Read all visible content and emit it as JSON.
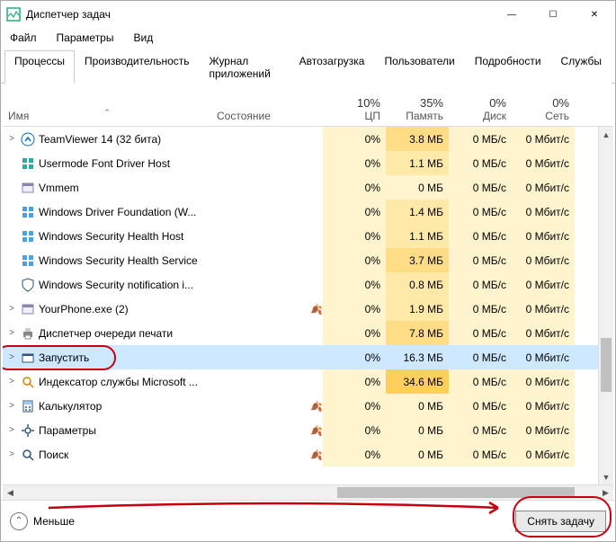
{
  "window": {
    "title": "Диспетчер задач",
    "min": "—",
    "max": "☐",
    "close": "✕"
  },
  "menu": {
    "file": "Файл",
    "options": "Параметры",
    "view": "Вид"
  },
  "tabs": {
    "processes": "Процессы",
    "performance": "Производительность",
    "app_history": "Журнал приложений",
    "startup": "Автозагрузка",
    "users": "Пользователи",
    "details": "Подробности",
    "services": "Службы"
  },
  "columns": {
    "name": "Имя",
    "status": "Состояние",
    "cpu_pct": "10%",
    "cpu_label": "ЦП",
    "mem_pct": "35%",
    "mem_label": "Память",
    "disk_pct": "0%",
    "disk_label": "Диск",
    "net_pct": "0%",
    "net_label": "Сеть"
  },
  "rows": [
    {
      "exp": ">",
      "name": "TeamViewer 14 (32 бита)",
      "cpu": "0%",
      "mem": "3.8 МБ",
      "disk": "0 МБ/с",
      "net": "0 Мбит/с",
      "mem_heat": "med",
      "leaf": false,
      "icon": "tv"
    },
    {
      "exp": "",
      "name": "Usermode Font Driver Host",
      "cpu": "0%",
      "mem": "1.1 МБ",
      "disk": "0 МБ/с",
      "net": "0 Мбит/с",
      "mem_heat": "light",
      "leaf": false,
      "icon": "win"
    },
    {
      "exp": "",
      "name": "Vmmem",
      "cpu": "0%",
      "mem": "0 МБ",
      "disk": "0 МБ/с",
      "net": "0 Мбит/с",
      "mem_heat": "none",
      "leaf": false,
      "icon": "exe"
    },
    {
      "exp": "",
      "name": "Windows Driver Foundation (W...",
      "cpu": "0%",
      "mem": "1.4 МБ",
      "disk": "0 МБ/с",
      "net": "0 Мбит/с",
      "mem_heat": "light",
      "leaf": false,
      "icon": "svc"
    },
    {
      "exp": "",
      "name": "Windows Security Health Host",
      "cpu": "0%",
      "mem": "1.1 МБ",
      "disk": "0 МБ/с",
      "net": "0 Мбит/с",
      "mem_heat": "light",
      "leaf": false,
      "icon": "svc"
    },
    {
      "exp": "",
      "name": "Windows Security Health Service",
      "cpu": "0%",
      "mem": "3.7 МБ",
      "disk": "0 МБ/с",
      "net": "0 Мбит/с",
      "mem_heat": "med",
      "leaf": false,
      "icon": "svc"
    },
    {
      "exp": "",
      "name": "Windows Security notification i...",
      "cpu": "0%",
      "mem": "0.8 МБ",
      "disk": "0 МБ/с",
      "net": "0 Мбит/с",
      "mem_heat": "light",
      "leaf": false,
      "icon": "shield"
    },
    {
      "exp": ">",
      "name": "YourPhone.exe (2)",
      "cpu": "0%",
      "mem": "1.9 МБ",
      "disk": "0 МБ/с",
      "net": "0 Мбит/с",
      "mem_heat": "light",
      "leaf": true,
      "icon": "exe"
    },
    {
      "exp": ">",
      "name": "Диспетчер очереди печати",
      "cpu": "0%",
      "mem": "7.8 МБ",
      "disk": "0 МБ/с",
      "net": "0 Мбит/с",
      "mem_heat": "med",
      "leaf": false,
      "icon": "printer"
    },
    {
      "exp": ">",
      "name": "Запустить",
      "cpu": "0%",
      "mem": "16.3 МБ",
      "disk": "0 МБ/с",
      "net": "0 Мбит/с",
      "mem_heat": "dark",
      "leaf": false,
      "icon": "run",
      "selected": true
    },
    {
      "exp": ">",
      "name": "Индексатор службы Microsoft ...",
      "cpu": "0%",
      "mem": "34.6 МБ",
      "disk": "0 МБ/с",
      "net": "0 Мбит/с",
      "mem_heat": "dark",
      "leaf": false,
      "icon": "index"
    },
    {
      "exp": ">",
      "name": "Калькулятор",
      "cpu": "0%",
      "mem": "0 МБ",
      "disk": "0 МБ/с",
      "net": "0 Мбит/с",
      "mem_heat": "none",
      "leaf": true,
      "icon": "calc"
    },
    {
      "exp": ">",
      "name": "Параметры",
      "cpu": "0%",
      "mem": "0 МБ",
      "disk": "0 МБ/с",
      "net": "0 Мбит/с",
      "mem_heat": "none",
      "leaf": true,
      "icon": "gear"
    },
    {
      "exp": ">",
      "name": "Поиск",
      "cpu": "0%",
      "mem": "0 МБ",
      "disk": "0 МБ/с",
      "net": "0 Мбит/с",
      "mem_heat": "none",
      "leaf": true,
      "icon": "search"
    }
  ],
  "footer": {
    "fewer": "Меньше",
    "end_task": "Снять задачу"
  }
}
